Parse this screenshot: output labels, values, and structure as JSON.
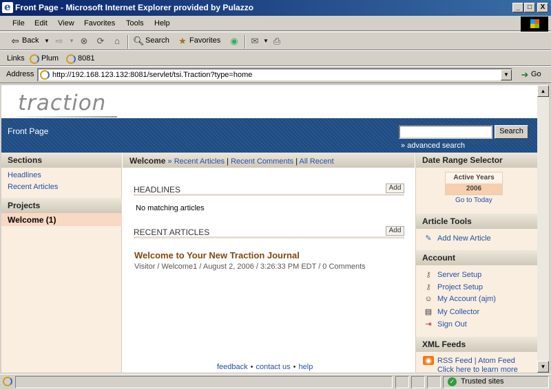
{
  "window": {
    "title": "Front Page - Microsoft Internet Explorer provided by Pulazzo",
    "min": "_",
    "max": "□",
    "close": "X"
  },
  "menu": [
    "File",
    "Edit",
    "View",
    "Favorites",
    "Tools",
    "Help"
  ],
  "toolbar": {
    "back": "Back",
    "search": "Search",
    "favorites": "Favorites"
  },
  "links": {
    "label": "Links",
    "items": [
      "Plum",
      "8081"
    ]
  },
  "address": {
    "label": "Address",
    "url": "http://192.168.123.132:8081/servlet/tsi.Traction?type=home",
    "go": "Go"
  },
  "page": {
    "logo": "traction",
    "banner": {
      "title": "Front Page",
      "search_button": "Search",
      "advanced": "» advanced search"
    },
    "left": {
      "sections_title": "Sections",
      "sections": [
        "Headlines",
        "Recent Articles"
      ],
      "projects_title": "Projects",
      "project_selected": "Welcome (1)"
    },
    "crumb": {
      "current": "Welcome",
      "sep": "»",
      "links": [
        "Recent Articles",
        "Recent Comments",
        "All Recent"
      ]
    },
    "headlines": {
      "title": "HEADLINES",
      "add": "Add",
      "empty": "No matching articles"
    },
    "recent": {
      "title": "RECENT ARTICLES",
      "add": "Add",
      "article_title": "Welcome to Your New Traction Journal",
      "article_meta": "Visitor / Welcome1 / August 2, 2006 / 3:26:33 PM EDT / 0 Comments"
    },
    "footer": [
      "feedback",
      "contact us",
      "help"
    ],
    "right": {
      "date_title": "Date Range Selector",
      "active_years_label": "Active Years",
      "year": "2006",
      "go_today": "Go to Today",
      "tools_title": "Article Tools",
      "add_article": "Add New Article",
      "account_title": "Account",
      "account_items": [
        "Server Setup",
        "Project Setup",
        "My Account (ajm)",
        "My Collector",
        "Sign Out"
      ],
      "xml_title": "XML Feeds",
      "rss": "RSS Feed",
      "atom": "Atom Feed",
      "learn": "Click here to learn more"
    }
  },
  "status": {
    "zone": "Trusted sites"
  }
}
